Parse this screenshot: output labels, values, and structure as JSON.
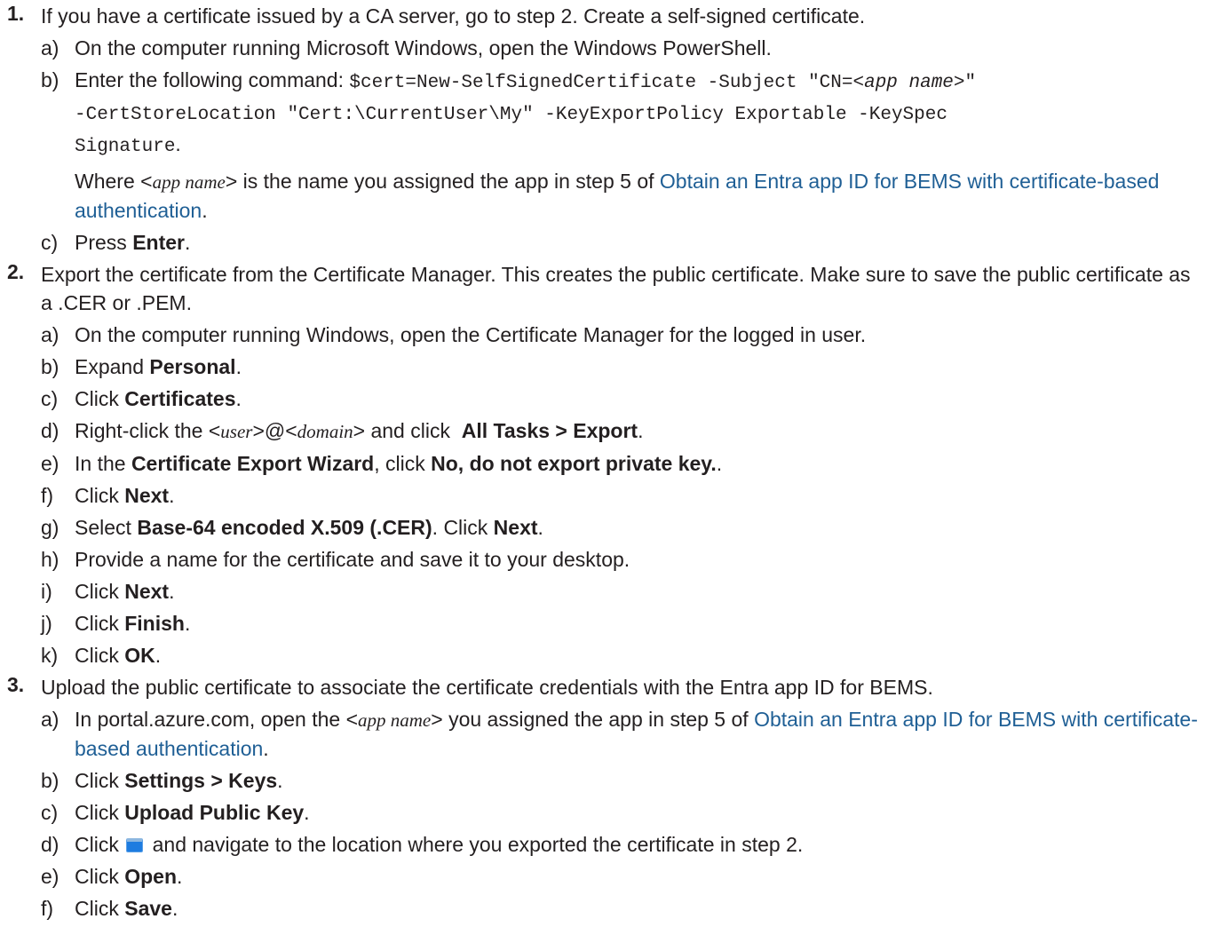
{
  "steps": [
    {
      "number": "1.",
      "text": "If you have a certificate issued by a CA server, go to step 2. Create a self-signed certificate.",
      "substeps": {
        "a": {
          "letter": "a)",
          "text": "On the computer running Microsoft Windows, open the Windows PowerShell."
        },
        "b": {
          "letter": "b)",
          "lead": "Enter the following command: ",
          "cmd_1": "$cert=New-SelfSignedCertificate -Subject \"CN=<",
          "cmd_var": "app name",
          "cmd_2": ">\"",
          "cmd_3": "-CertStoreLocation \"Cert:\\CurrentUser\\My\" -KeyExportPolicy Exportable -KeySpec",
          "cmd_4": "Signature",
          "cmd_end": ".",
          "where_1": "Where <",
          "where_var": "app name",
          "where_2": "> is the name you assigned the app in step 5 of ",
          "link": "Obtain an Entra app ID for BEMS with certificate-based authentication",
          "where_end": "."
        },
        "c": {
          "letter": "c)",
          "pre": "Press ",
          "bold": "Enter",
          "post": "."
        }
      }
    },
    {
      "number": "2.",
      "text": "Export the certificate from the Certificate Manager. This creates the public certificate. Make sure to save the public certificate as a .CER or .PEM.",
      "substeps": {
        "a": {
          "letter": "a)",
          "text": "On the computer running Windows, open the Certificate Manager for the logged in user."
        },
        "b": {
          "letter": "b)",
          "pre": "Expand ",
          "bold": "Personal",
          "post": "."
        },
        "c": {
          "letter": "c)",
          "pre": "Click ",
          "bold": "Certificates",
          "post": "."
        },
        "d": {
          "letter": "d)",
          "pre": "Right-click the <",
          "var1": "user",
          "mid": ">@<",
          "var2": "domain",
          "mid2": "> and click  ",
          "bold": "All Tasks > Export",
          "post": "."
        },
        "e": {
          "letter": "e)",
          "pre": "In the ",
          "bold1": "Certificate Export Wizard",
          "mid": ", click ",
          "bold2": "No, do not export private key.",
          "post": "."
        },
        "f": {
          "letter": "f)",
          "pre": "Click ",
          "bold": "Next",
          "post": "."
        },
        "g": {
          "letter": "g)",
          "pre": "Select ",
          "bold1": "Base-64 encoded X.509 (.CER)",
          "mid": ". Click ",
          "bold2": "Next",
          "post": "."
        },
        "h": {
          "letter": "h)",
          "text": "Provide a name for the certificate and save it to your desktop."
        },
        "i": {
          "letter": "i)",
          "pre": "Click ",
          "bold": "Next",
          "post": "."
        },
        "j": {
          "letter": "j)",
          "pre": "Click ",
          "bold": "Finish",
          "post": "."
        },
        "k": {
          "letter": "k)",
          "pre": "Click ",
          "bold": "OK",
          "post": "."
        }
      }
    },
    {
      "number": "3.",
      "text": "Upload the public certificate to associate the certificate credentials with the Entra app ID for BEMS.",
      "substeps": {
        "a": {
          "letter": "a)",
          "pre": "In portal.azure.com, open the <",
          "var": "app name",
          "mid": "> you assigned the app in step 5 of ",
          "link": "Obtain an Entra app ID for BEMS with certificate-based authentication",
          "post": "."
        },
        "b": {
          "letter": "b)",
          "pre": "Click ",
          "bold": "Settings > Keys",
          "post": "."
        },
        "c": {
          "letter": "c)",
          "pre": "Click ",
          "bold": "Upload Public Key",
          "post": "."
        },
        "d": {
          "letter": "d)",
          "pre": "Click ",
          "icon": "folder-icon",
          "post": " and navigate to the location where you exported the certificate in step 2."
        },
        "e": {
          "letter": "e)",
          "pre": "Click ",
          "bold": "Open",
          "post": "."
        },
        "f": {
          "letter": "f)",
          "pre": "Click ",
          "bold": "Save",
          "post": "."
        }
      }
    }
  ],
  "colors": {
    "text": "#231f20",
    "link": "#1f5f95"
  }
}
